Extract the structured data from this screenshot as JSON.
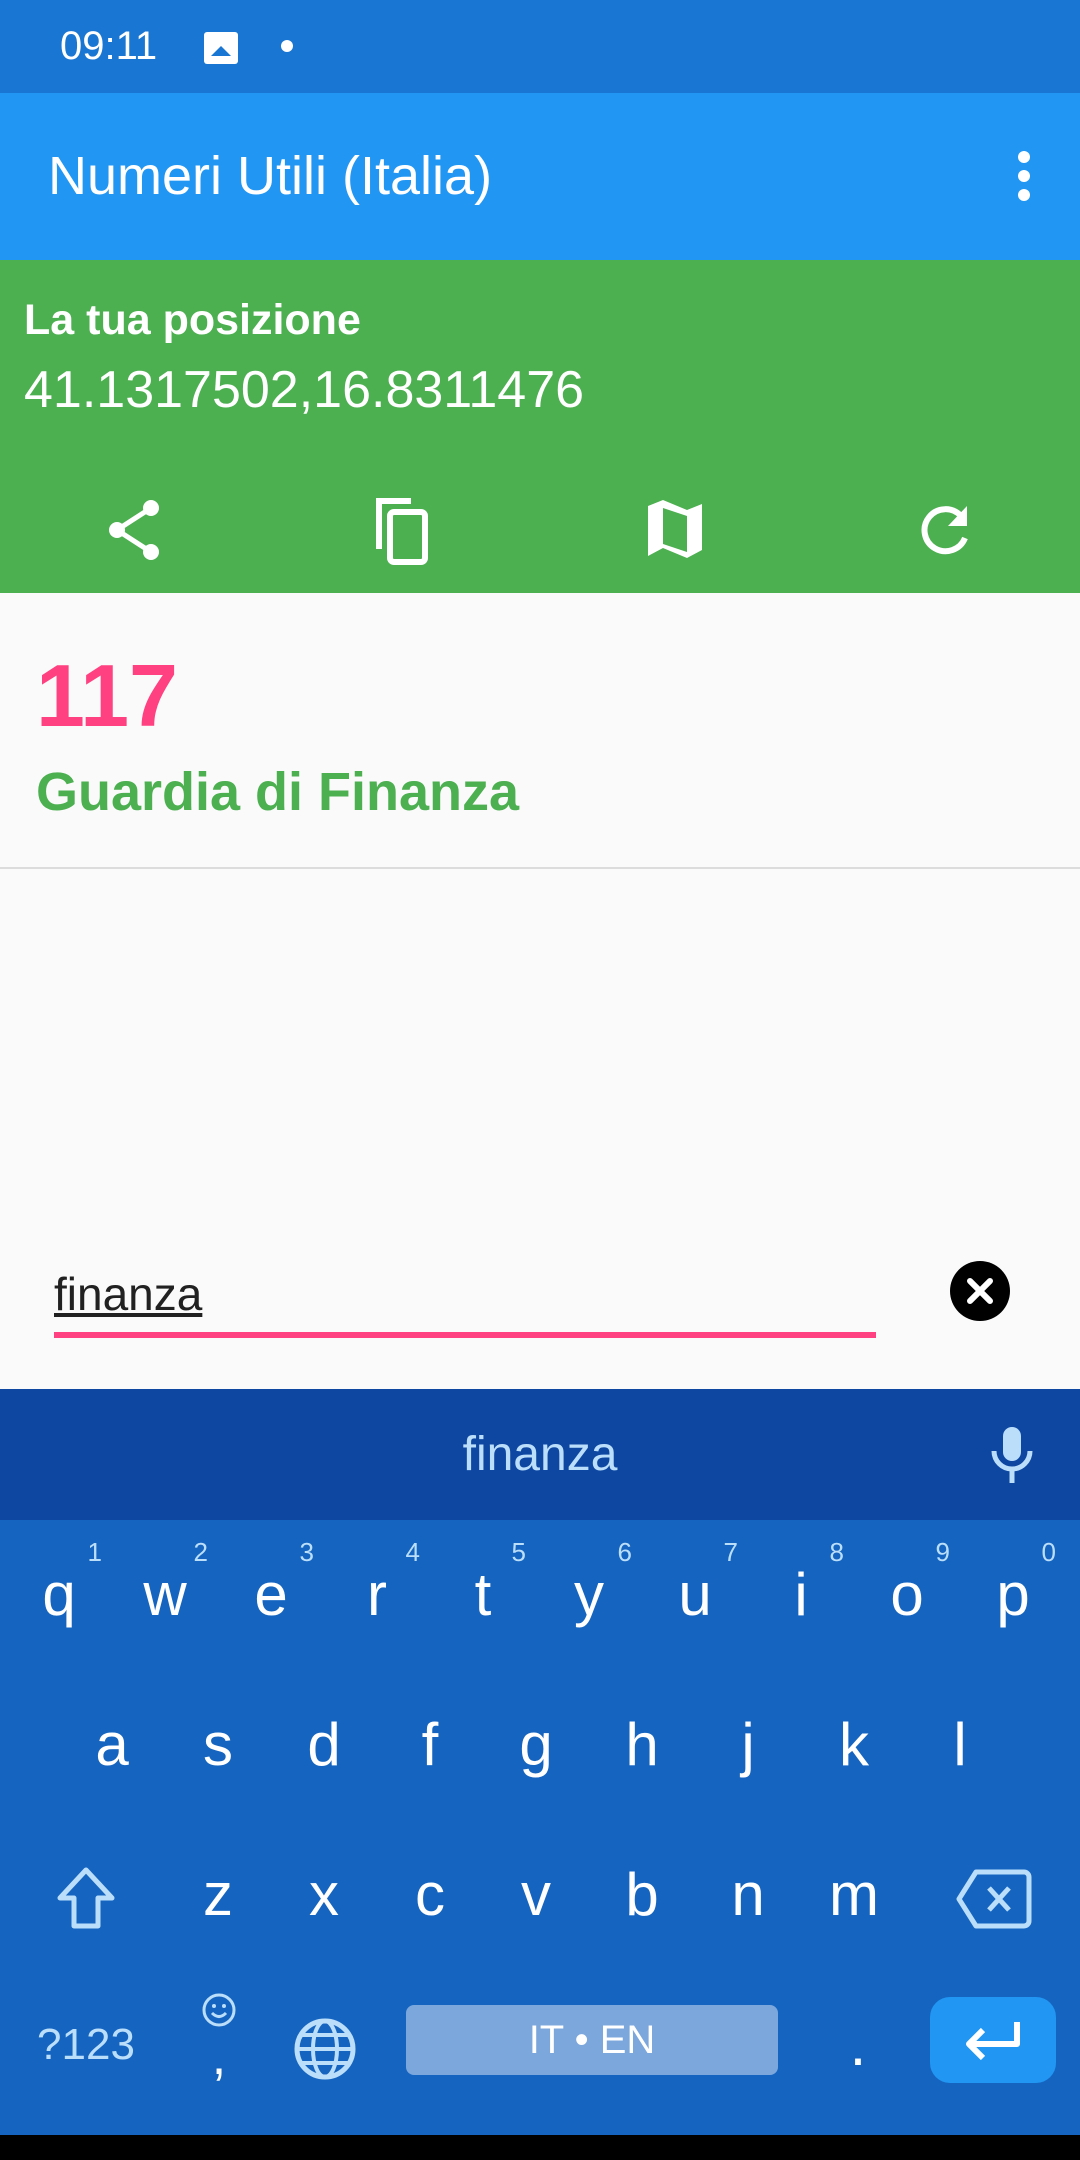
{
  "status_bar": {
    "time": "09:11",
    "left_icons": [
      "image-notification-icon",
      "dot-icon"
    ],
    "right_icons": [
      "alarm-icon",
      "location-icon",
      "signal-no-data-icon",
      "battery-icon"
    ]
  },
  "app_bar": {
    "title": "Numeri Utili (Italia)",
    "menu_icon": "more-vert-icon"
  },
  "location": {
    "label": "La tua posizione",
    "coordinates": "41.1317502,16.8311476",
    "actions": [
      {
        "name": "share",
        "icon": "share-icon"
      },
      {
        "name": "copy",
        "icon": "copy-icon"
      },
      {
        "name": "map",
        "icon": "map-icon"
      },
      {
        "name": "refresh",
        "icon": "refresh-icon"
      }
    ]
  },
  "results": [
    {
      "number": "117",
      "name": "Guardia di Finanza"
    }
  ],
  "search": {
    "value": "finanza",
    "clear_icon": "clear-icon"
  },
  "keyboard": {
    "suggestion": "finanza",
    "row1": [
      {
        "key": "q",
        "hint": "1"
      },
      {
        "key": "w",
        "hint": "2"
      },
      {
        "key": "e",
        "hint": "3"
      },
      {
        "key": "r",
        "hint": "4"
      },
      {
        "key": "t",
        "hint": "5"
      },
      {
        "key": "y",
        "hint": "6"
      },
      {
        "key": "u",
        "hint": "7"
      },
      {
        "key": "i",
        "hint": "8"
      },
      {
        "key": "o",
        "hint": "9"
      },
      {
        "key": "p",
        "hint": "0"
      }
    ],
    "row2": [
      "a",
      "s",
      "d",
      "f",
      "g",
      "h",
      "j",
      "k",
      "l"
    ],
    "row3": [
      "z",
      "x",
      "c",
      "v",
      "b",
      "n",
      "m"
    ],
    "symbols_label": "?123",
    "comma": ",",
    "space_label": "IT • EN",
    "period": ".",
    "colors": {
      "background": "#1565c0",
      "suggestion_strip": "#0d47a1",
      "enter": "#2196f3"
    }
  },
  "colors": {
    "status_bar": "#1976d2",
    "app_bar": "#2196f3",
    "location_panel": "#4caf50",
    "number": "#ff4081",
    "name": "#4caf50",
    "accent": "#ff4081"
  }
}
